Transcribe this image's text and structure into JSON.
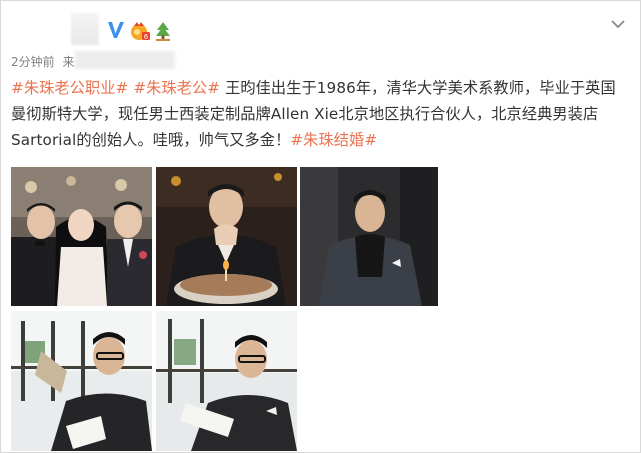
{
  "post": {
    "time": "2分钟前",
    "source_prefix": "来",
    "text_parts": [
      {
        "type": "tag",
        "text": "#朱珠老公职业#"
      },
      {
        "type": "text",
        "text": " "
      },
      {
        "type": "tag",
        "text": "#朱珠老公#"
      },
      {
        "type": "text",
        "text": " 王昀佳出生于1986年，清华大学美术系教师，毕业于英国曼彻斯特大学，现任男士西装定制品牌Allen Xie北京地区执行合伙人，北京经典男装店Sartorial的创始人。哇哦，帅气又多金！"
      },
      {
        "type": "tag",
        "text": "#朱珠结婚#"
      }
    ]
  },
  "badges": {
    "verified": "V",
    "verified_color": "#3d8ff0",
    "gold_color": "#f5a623"
  },
  "icons": [
    "verified-v-icon",
    "gold-member-badge-icon",
    "tree-badge-icon",
    "chevron-down-icon"
  ],
  "colors": {
    "hashtag": "#eb7350",
    "text": "#333333",
    "meta": "#808080",
    "border": "#d9d9d9"
  },
  "photos": [
    "wedding-group-photo",
    "birthday-cake-photo",
    "dark-suit-portrait-photo",
    "reading-menu-photo-1",
    "reading-menu-photo-2"
  ]
}
